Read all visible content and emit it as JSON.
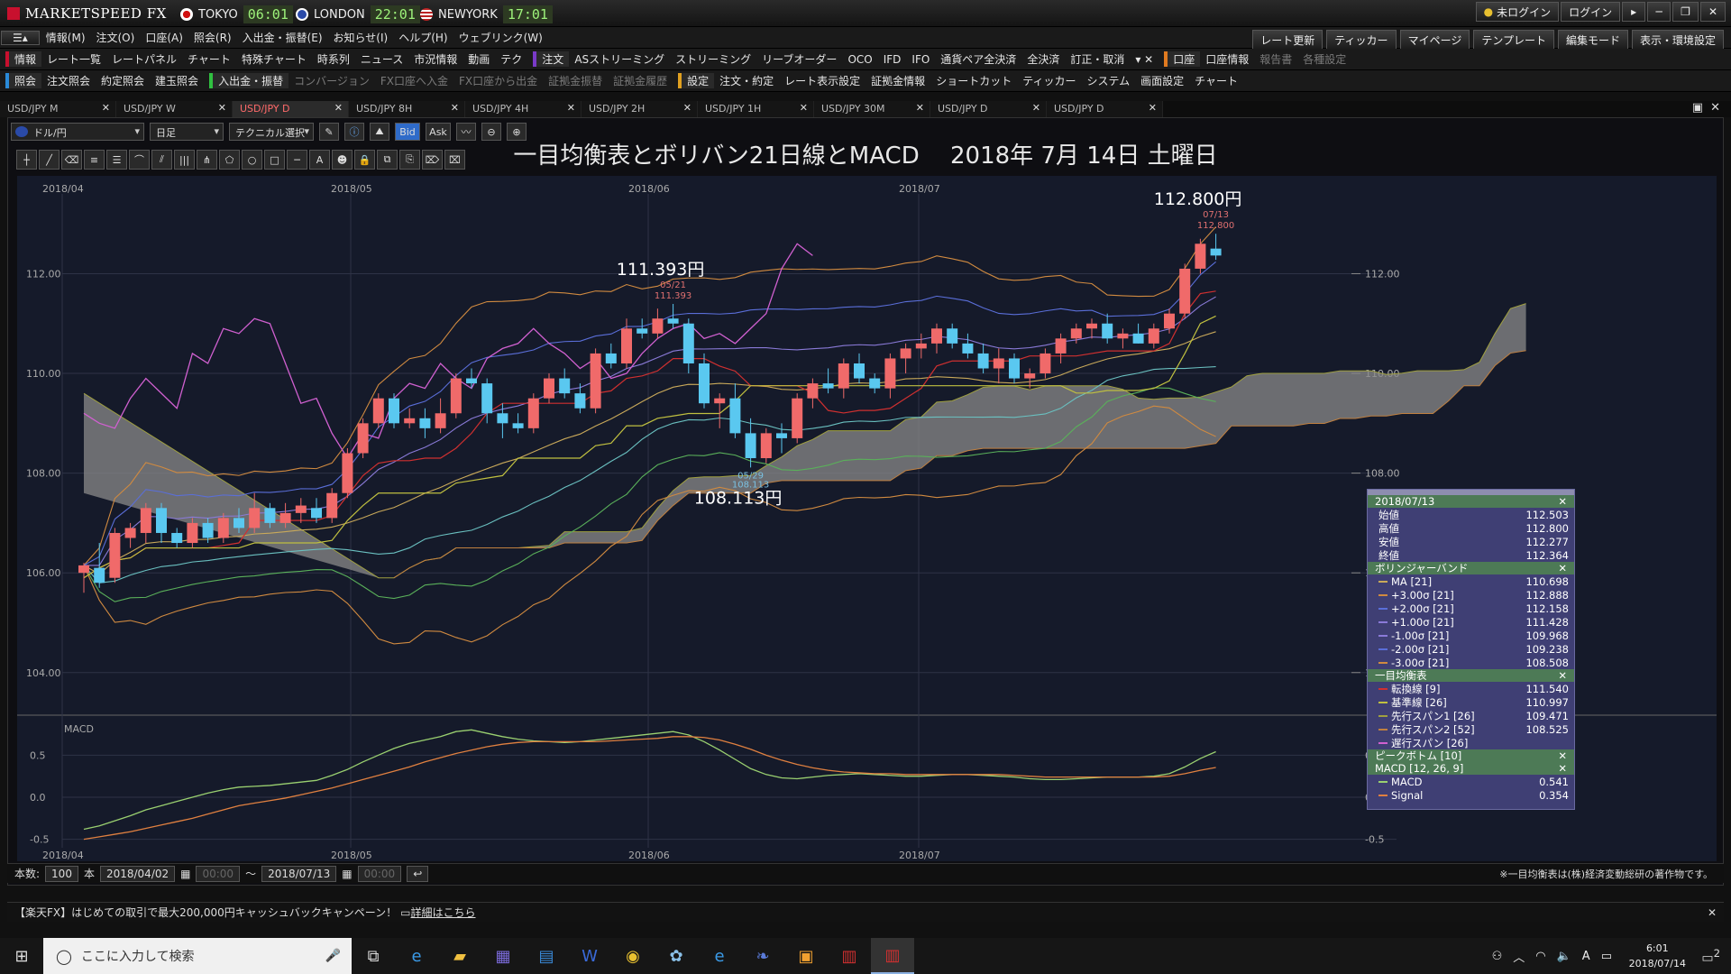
{
  "app": {
    "name": "MARKETSPEED FX",
    "clocks": [
      {
        "city": "TOKYO",
        "time": "06:01",
        "color": "#d01010"
      },
      {
        "city": "LONDON",
        "time": "22:01",
        "color": "#2a4aa8"
      },
      {
        "city": "NEWYORK",
        "time": "17:01",
        "color": "#2a4aa8"
      }
    ],
    "login_status": "未ログイン",
    "login_button": "ログイン"
  },
  "menu": [
    "情報(M)",
    "注文(O)",
    "口座(A)",
    "照会(R)",
    "入出金・振替(E)",
    "お知らせ(I)",
    "ヘルプ(H)",
    "ウェブリンク(W)"
  ],
  "toolbar_right": [
    "レート更新",
    "ティッカー",
    "マイページ",
    "テンプレート",
    "編集モード",
    "表示・環境設定"
  ],
  "toolbar1": {
    "info_label": "情報",
    "info_items": [
      "レート一覧",
      "レートパネル",
      "チャート",
      "特殊チャート",
      "時系列",
      "ニュース",
      "市況情報",
      "動画",
      "テク"
    ],
    "order_label": "注文",
    "order_items": [
      "ASストリーミング",
      "ストリーミング",
      "リーブオーダー",
      "OCO",
      "IFD",
      "IFO",
      "通貨ペア全決済",
      "全決済",
      "訂正・取消"
    ],
    "account_label": "口座",
    "account_items": [
      "口座情報",
      "報告書",
      "各種設定"
    ]
  },
  "toolbar2": {
    "inquiry_label": "照会",
    "inquiry_items": [
      "注文照会",
      "約定照会",
      "建玉照会"
    ],
    "deposit_label": "入出金・振替",
    "deposit_items": [
      "コンバージョン",
      "FX口座へ入金",
      "FX口座から出金",
      "証拠金振替",
      "証拠金履歴"
    ],
    "settings_label": "設定",
    "settings_items": [
      "注文・約定",
      "レート表示設定",
      "証拠金情報",
      "ショートカット",
      "ティッカー",
      "システム",
      "画面設定",
      "チャート"
    ]
  },
  "tabs": [
    "USD/JPY M",
    "USD/JPY W",
    "USD/JPY D",
    "USD/JPY 8H",
    "USD/JPY 4H",
    "USD/JPY 2H",
    "USD/JPY 1H",
    "USD/JPY 30M",
    "USD/JPY D",
    "USD/JPY D"
  ],
  "active_tab": 2,
  "chart_toolbar": {
    "pair": "ドル/円",
    "period": "日足",
    "technical": "テクニカル選択",
    "bid": "Bid",
    "ask": "Ask"
  },
  "chart_title": "一目均衡表とボリバン21日線とMACD　 2018年 7月 14日 土曜日",
  "annotations": [
    {
      "price": "112.800円",
      "date": "07/13",
      "value": "112.800"
    },
    {
      "price": "111.393円",
      "date": "05/21",
      "value": "111.393"
    },
    {
      "price": "108.113円",
      "date": "05/29",
      "value": "108.113"
    }
  ],
  "chart_data": [
    {
      "type": "candlestick",
      "instrument": "USD/JPY",
      "timeframe": "日足",
      "x_ticks": [
        "2018/04",
        "2018/05",
        "2018/06",
        "2018/07"
      ],
      "y_ticks": [
        "104.00",
        "106.00",
        "108.00",
        "110.00",
        "112.00"
      ],
      "ylim": [
        103.2,
        113.6
      ],
      "candles": [
        [
          106.0,
          106.2,
          105.6,
          106.15
        ],
        [
          106.1,
          106.6,
          105.7,
          105.8
        ],
        [
          105.9,
          106.9,
          105.8,
          106.8
        ],
        [
          106.7,
          107.0,
          106.5,
          106.9
        ],
        [
          106.8,
          107.4,
          106.6,
          107.3
        ],
        [
          107.3,
          107.4,
          106.6,
          106.8
        ],
        [
          106.8,
          106.9,
          106.5,
          106.6
        ],
        [
          106.6,
          107.1,
          106.5,
          107.0
        ],
        [
          107.0,
          107.1,
          106.6,
          106.7
        ],
        [
          106.7,
          107.2,
          106.6,
          107.1
        ],
        [
          107.1,
          107.3,
          106.8,
          106.9
        ],
        [
          106.9,
          107.6,
          106.8,
          107.3
        ],
        [
          107.3,
          107.4,
          106.9,
          107.0
        ],
        [
          107.0,
          107.4,
          106.9,
          107.2
        ],
        [
          107.2,
          107.5,
          107.0,
          107.35
        ],
        [
          107.3,
          107.5,
          107.0,
          107.1
        ],
        [
          107.1,
          107.7,
          107.0,
          107.6
        ],
        [
          107.6,
          108.5,
          107.5,
          108.4
        ],
        [
          108.4,
          109.1,
          108.3,
          109.0
        ],
        [
          109.0,
          109.6,
          108.9,
          109.5
        ],
        [
          109.5,
          109.6,
          108.9,
          109.0
        ],
        [
          109.0,
          109.3,
          108.9,
          109.1
        ],
        [
          109.1,
          109.3,
          108.7,
          108.9
        ],
        [
          108.9,
          109.5,
          108.8,
          109.2
        ],
        [
          109.2,
          110.0,
          109.1,
          109.9
        ],
        [
          109.9,
          110.1,
          109.7,
          109.8
        ],
        [
          109.8,
          109.9,
          109.0,
          109.2
        ],
        [
          109.2,
          109.4,
          108.7,
          109.0
        ],
        [
          109.0,
          109.2,
          108.8,
          108.9
        ],
        [
          108.9,
          109.6,
          108.8,
          109.5
        ],
        [
          109.5,
          110.0,
          109.4,
          109.9
        ],
        [
          109.9,
          110.1,
          109.5,
          109.6
        ],
        [
          109.6,
          109.8,
          109.2,
          109.3
        ],
        [
          109.3,
          110.5,
          109.2,
          110.4
        ],
        [
          110.4,
          110.6,
          110.1,
          110.2
        ],
        [
          110.2,
          111.1,
          110.1,
          110.9
        ],
        [
          110.9,
          111.1,
          110.7,
          110.8
        ],
        [
          110.8,
          111.3,
          110.7,
          111.1
        ],
        [
          111.1,
          111.393,
          110.9,
          111.0
        ],
        [
          111.0,
          111.1,
          110.0,
          110.2
        ],
        [
          110.2,
          110.4,
          109.3,
          109.4
        ],
        [
          109.4,
          109.6,
          108.9,
          109.5
        ],
        [
          109.5,
          109.8,
          108.7,
          108.8
        ],
        [
          108.8,
          109.1,
          108.113,
          108.3
        ],
        [
          108.3,
          108.9,
          108.2,
          108.8
        ],
        [
          108.8,
          109.0,
          108.4,
          108.7
        ],
        [
          108.7,
          109.6,
          108.6,
          109.5
        ],
        [
          109.5,
          109.9,
          109.3,
          109.8
        ],
        [
          109.8,
          110.1,
          109.6,
          109.7
        ],
        [
          109.7,
          110.3,
          109.5,
          110.2
        ],
        [
          110.2,
          110.4,
          109.8,
          109.9
        ],
        [
          109.9,
          110.0,
          109.6,
          109.7
        ],
        [
          109.7,
          110.4,
          109.5,
          110.3
        ],
        [
          110.3,
          110.6,
          110.0,
          110.5
        ],
        [
          110.5,
          110.8,
          110.3,
          110.6
        ],
        [
          110.6,
          111.0,
          110.4,
          110.9
        ],
        [
          110.9,
          111.0,
          110.5,
          110.6
        ],
        [
          110.6,
          110.8,
          110.3,
          110.4
        ],
        [
          110.4,
          110.6,
          110.0,
          110.1
        ],
        [
          110.1,
          110.5,
          109.8,
          110.3
        ],
        [
          110.3,
          110.4,
          109.8,
          109.9
        ],
        [
          109.9,
          110.1,
          109.7,
          110.0
        ],
        [
          110.0,
          110.5,
          109.9,
          110.4
        ],
        [
          110.4,
          110.8,
          110.2,
          110.7
        ],
        [
          110.7,
          111.0,
          110.6,
          110.9
        ],
        [
          110.9,
          111.1,
          110.7,
          111.0
        ],
        [
          111.0,
          111.2,
          110.6,
          110.7
        ],
        [
          110.7,
          110.9,
          110.5,
          110.8
        ],
        [
          110.8,
          111.0,
          110.6,
          110.6
        ],
        [
          110.6,
          111.0,
          110.5,
          110.9
        ],
        [
          110.9,
          111.3,
          110.8,
          111.2
        ],
        [
          111.2,
          112.2,
          111.1,
          112.1
        ],
        [
          112.1,
          112.7,
          112.0,
          112.6
        ],
        [
          112.503,
          112.8,
          112.277,
          112.364
        ]
      ],
      "bollinger_21": {
        "ma": "#c9a95a",
        "bands": [
          "#d08a40",
          "#5a6ed8",
          "#8a7ad8",
          "#6ac0c0",
          "#5ab05a"
        ]
      },
      "ichimoku": {
        "tenkan": "#d03030",
        "kijun": "#c0c040",
        "chikou": "#d060d0",
        "cloud": "#8a8a8a"
      }
    },
    {
      "type": "line",
      "title": "MACD",
      "x_ticks": [
        "2018/04",
        "2018/05",
        "2018/06",
        "2018/07"
      ],
      "y_ticks": [
        "0.5",
        "0.0",
        "-0.5"
      ],
      "ylim": [
        -0.6,
        0.9
      ],
      "series": [
        {
          "name": "MACD",
          "color": "#9ad070",
          "values": [
            -0.38,
            -0.34,
            -0.28,
            -0.22,
            -0.15,
            -0.1,
            -0.05,
            0.0,
            0.05,
            0.09,
            0.12,
            0.13,
            0.14,
            0.16,
            0.18,
            0.2,
            0.26,
            0.33,
            0.42,
            0.5,
            0.58,
            0.64,
            0.68,
            0.72,
            0.78,
            0.8,
            0.76,
            0.72,
            0.69,
            0.67,
            0.66,
            0.65,
            0.66,
            0.68,
            0.7,
            0.72,
            0.74,
            0.76,
            0.78,
            0.74,
            0.66,
            0.56,
            0.45,
            0.34,
            0.27,
            0.23,
            0.22,
            0.24,
            0.26,
            0.27,
            0.28,
            0.27,
            0.26,
            0.25,
            0.25,
            0.26,
            0.27,
            0.27,
            0.26,
            0.25,
            0.24,
            0.22,
            0.21,
            0.21,
            0.22,
            0.23,
            0.24,
            0.24,
            0.24,
            0.25,
            0.28,
            0.36,
            0.46,
            0.541
          ]
        },
        {
          "name": "Signal",
          "color": "#e08040",
          "values": [
            -0.5,
            -0.47,
            -0.44,
            -0.41,
            -0.37,
            -0.33,
            -0.29,
            -0.25,
            -0.2,
            -0.15,
            -0.1,
            -0.07,
            -0.04,
            -0.01,
            0.03,
            0.07,
            0.11,
            0.16,
            0.21,
            0.26,
            0.31,
            0.36,
            0.42,
            0.47,
            0.52,
            0.56,
            0.6,
            0.63,
            0.65,
            0.66,
            0.66,
            0.66,
            0.66,
            0.66,
            0.67,
            0.68,
            0.69,
            0.7,
            0.72,
            0.72,
            0.71,
            0.68,
            0.63,
            0.57,
            0.5,
            0.44,
            0.39,
            0.35,
            0.32,
            0.3,
            0.29,
            0.28,
            0.28,
            0.27,
            0.27,
            0.27,
            0.27,
            0.27,
            0.27,
            0.27,
            0.26,
            0.25,
            0.24,
            0.24,
            0.24,
            0.24,
            0.24,
            0.24,
            0.24,
            0.24,
            0.25,
            0.28,
            0.32,
            0.354
          ]
        }
      ]
    }
  ],
  "info_panel": {
    "date": "2018/07/13",
    "ohlc": [
      [
        "始値",
        "112.503"
      ],
      [
        "高値",
        "112.800"
      ],
      [
        "安値",
        "112.277"
      ],
      [
        "終値",
        "112.364"
      ]
    ],
    "bb_title": "ボリンジャーバンド",
    "bb": [
      [
        "MA [21]",
        "110.698",
        "#c9a95a"
      ],
      [
        "+3.00σ [21]",
        "112.888",
        "#d08a40"
      ],
      [
        "+2.00σ [21]",
        "112.158",
        "#5a6ed8"
      ],
      [
        "+1.00σ [21]",
        "111.428",
        "#8a7ad8"
      ],
      [
        "-1.00σ [21]",
        "109.968",
        "#8a7ad8"
      ],
      [
        "-2.00σ [21]",
        "109.238",
        "#5a6ed8"
      ],
      [
        "-3.00σ [21]",
        "108.508",
        "#d08a40"
      ]
    ],
    "ichi_title": "一目均衡表",
    "ichi": [
      [
        "転換線 [9]",
        "111.540",
        "#d03030"
      ],
      [
        "基準線 [26]",
        "110.997",
        "#c0c040"
      ],
      [
        "先行スパン1 [26]",
        "109.471",
        "#a0a040"
      ],
      [
        "先行スパン2 [52]",
        "108.525",
        "#c08040"
      ],
      [
        "遅行スパン [26]",
        "",
        "#d060d0"
      ]
    ],
    "peak_title": "ピークボトム [10]",
    "macd_title": "MACD [12, 26, 9]",
    "macd": [
      [
        "MACD",
        "0.541",
        "#9ad070"
      ],
      [
        "Signal",
        "0.354",
        "#e08040"
      ]
    ]
  },
  "bottom": {
    "count_label": "本数:",
    "count": "100",
    "unit": "本",
    "date_from": "2018/04/02",
    "time_from": "00:00",
    "date_to": "2018/07/13",
    "time_to": "00:00",
    "copyright": "※一目均衡表は(株)経済変動総研の著作物です。"
  },
  "news": {
    "text": "【楽天FX】はじめての取引で最大200,000円キャッシュバックキャンペーン！",
    "link": "詳細はこちら"
  },
  "taskbar": {
    "search_placeholder": "ここに入力して検索",
    "time": "6:01",
    "date": "2018/07/14",
    "ime": "A",
    "notif": "2"
  }
}
